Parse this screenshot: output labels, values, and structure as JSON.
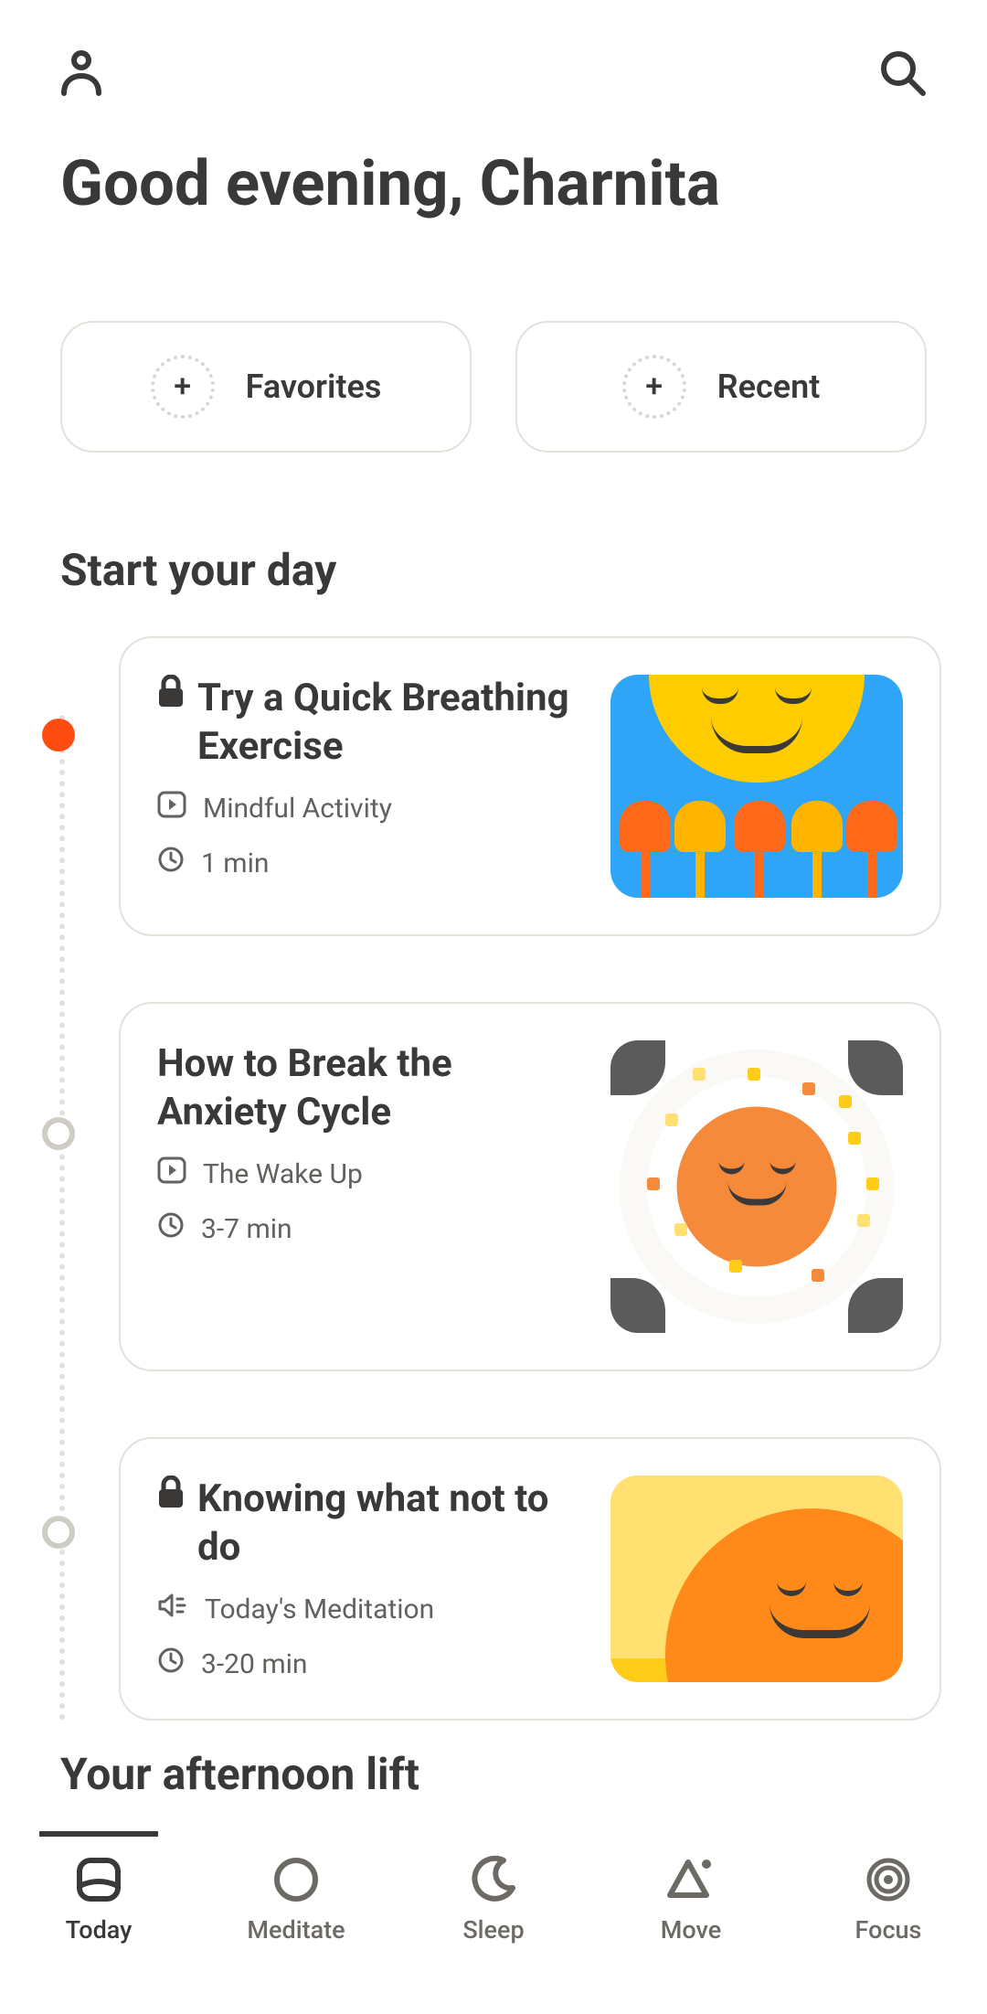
{
  "greeting": "Good evening, Charnita",
  "pills": {
    "favorites": "Favorites",
    "recent": "Recent"
  },
  "section1": {
    "title": "Start your day",
    "cards": [
      {
        "locked": true,
        "title": "Try a Quick Breathing Exercise",
        "type_label": "Mindful Activity",
        "type_icon": "play",
        "duration": "1 min"
      },
      {
        "locked": false,
        "title": "How to Break the Anxiety Cycle",
        "type_label": "The Wake Up",
        "type_icon": "play",
        "duration": "3-7 min"
      },
      {
        "locked": true,
        "title": "Knowing what not to do",
        "type_label": "Today's Meditation",
        "type_icon": "audio",
        "duration": "3-20 min"
      }
    ]
  },
  "section2": {
    "title": "Your afternoon lift"
  },
  "nav": {
    "today": "Today",
    "meditate": "Meditate",
    "sleep": "Sleep",
    "move": "Move",
    "focus": "Focus"
  }
}
